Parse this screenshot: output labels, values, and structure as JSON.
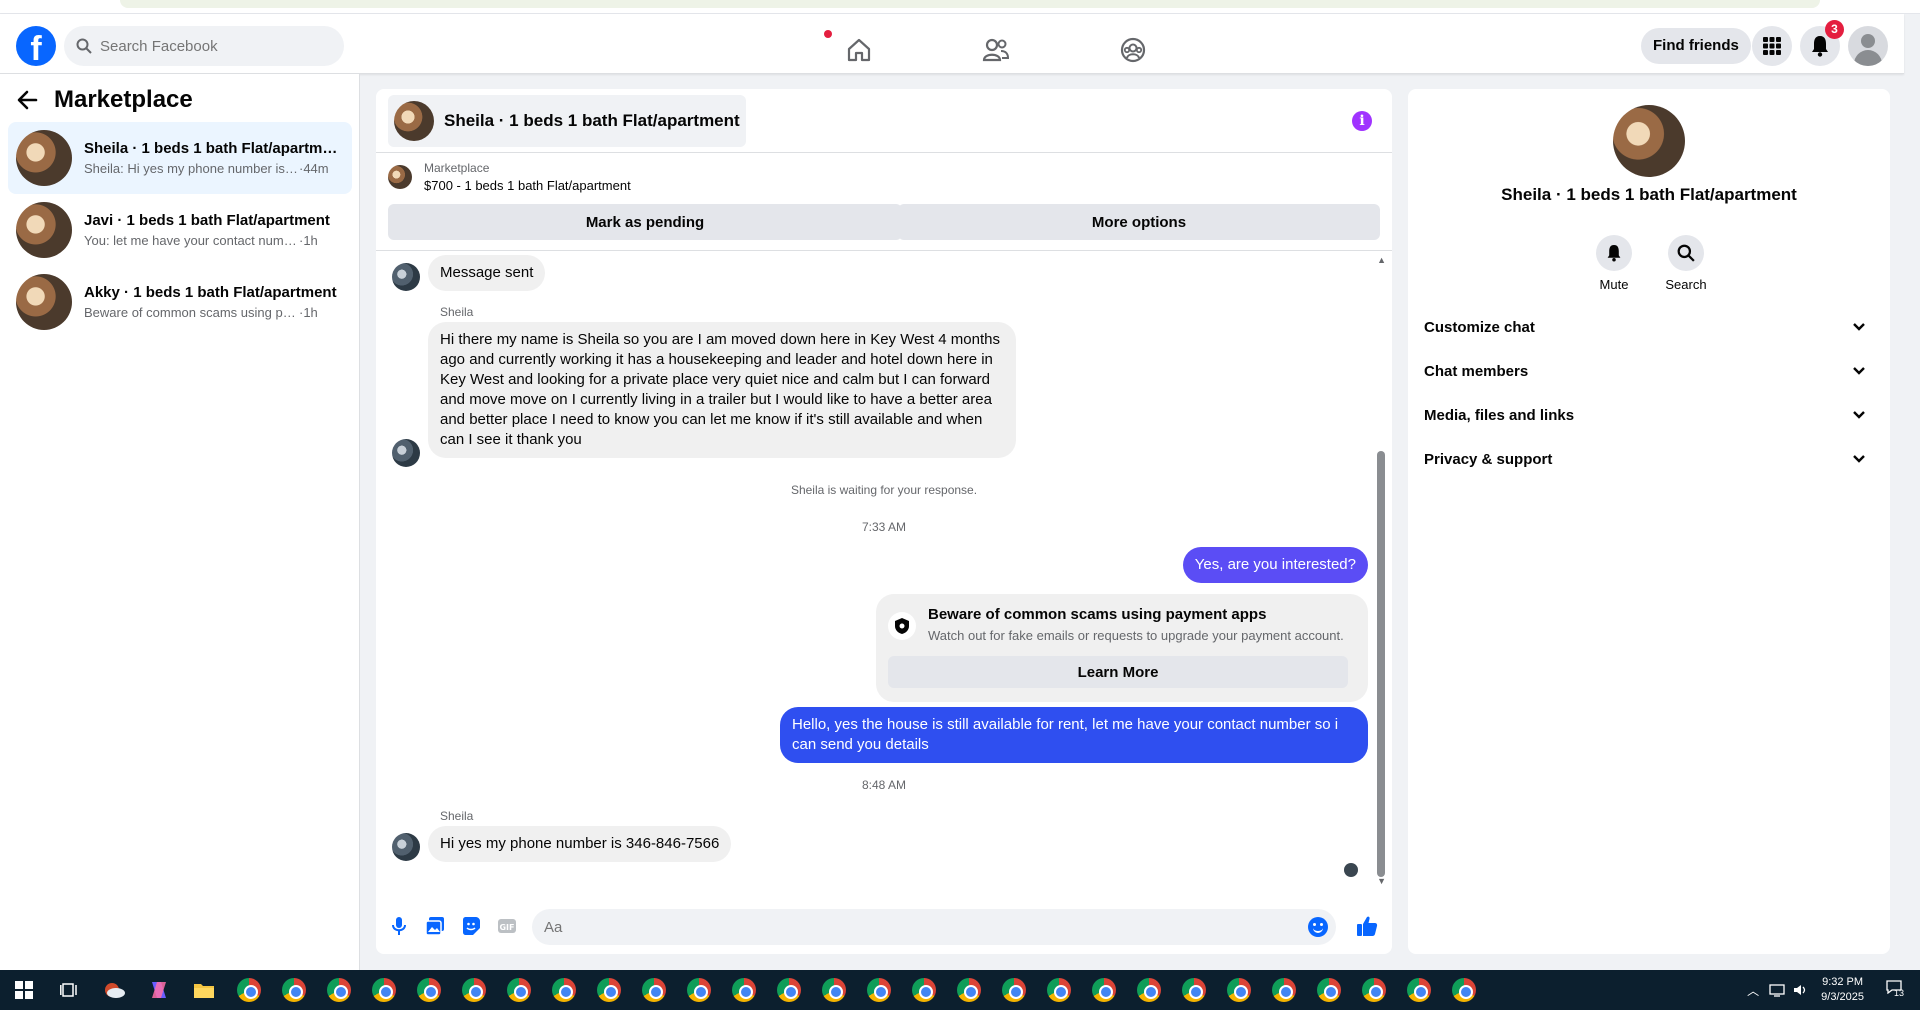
{
  "topbar": {
    "search_placeholder": "Search Facebook",
    "find_friends_label": "Find friends",
    "notification_count": "3"
  },
  "sidebar": {
    "title": "Marketplace",
    "conversations": [
      {
        "title": "Sheila · 1 beds 1 bath Flat/apartment",
        "preview": "Sheila: Hi yes my phone number is ...",
        "time": "·44m",
        "active": true
      },
      {
        "title": "Javi · 1 beds 1 bath Flat/apartment",
        "preview": "You: let me have your contact number...",
        "time": "·1h",
        "active": false
      },
      {
        "title": "Akky · 1 beds 1 bath Flat/apartment",
        "preview": "Beware of common scams using pay...",
        "time": "·1h",
        "active": false
      }
    ]
  },
  "chat": {
    "title": "Sheila · 1 beds 1 bath Flat/apartment",
    "listing_label": "Marketplace",
    "listing_price": "$700 - 1 beds 1 bath Flat/apartment",
    "mark_pending_label": "Mark as pending",
    "more_options_label": "More options",
    "messages": {
      "msg1": "Message sent",
      "sender1": "Sheila",
      "msg2": "Hi there my name is Sheila so you are I am moved down here in Key West 4 months ago and currently working it has a housekeeping and leader and hotel down here in Key West and looking for a private place very quiet nice and calm but I can forward and move move on I currently living in a trailer but I would like to have a better area and better place I need to know you can let me know if it's still available and when can I see it thank you",
      "waiting": "Sheila is waiting for your response.",
      "time1": "7:33 AM",
      "out1": "Yes, are you interested?",
      "scam_title": "Beware of common scams using payment apps",
      "scam_sub": "Watch out for fake emails or requests to upgrade your payment account.",
      "learn_more": "Learn More",
      "out2": "Hello, yes the house is still available for rent, let me have your contact number so i can send you details",
      "time2": "8:48 AM",
      "sender2": "Sheila",
      "msg3": "Hi yes my phone number is 346-846-7566"
    },
    "composer_placeholder": "Aa"
  },
  "right_panel": {
    "name": "Sheila · 1 beds 1 bath Flat/apartment",
    "mute_label": "Mute",
    "search_label": "Search",
    "sections": [
      "Customize chat",
      "Chat members",
      "Media, files and links",
      "Privacy & support"
    ]
  },
  "taskbar": {
    "time": "9:32 PM",
    "date": "9/3/2025",
    "notif_count": "13"
  },
  "colors": {
    "fb_blue": "#0866ff",
    "outgoing_purple": "#5b4df5",
    "outgoing_blue": "#2f4ff0",
    "badge_red": "#e41e3f"
  }
}
